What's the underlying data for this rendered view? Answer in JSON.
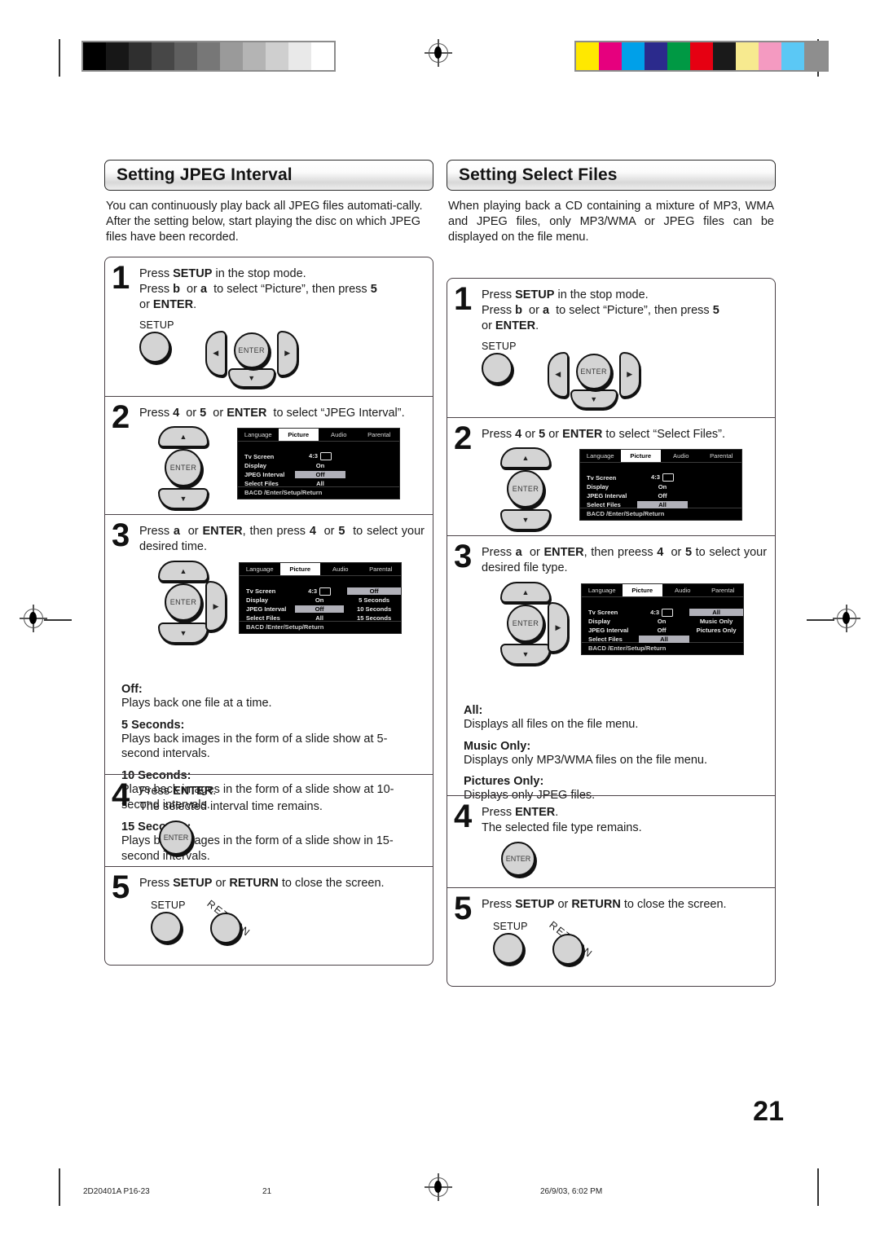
{
  "document": {
    "page_number": "21",
    "footer": {
      "doc_code": "2D20401A P16-23",
      "page_label": "21",
      "timestamp": "26/9/03, 6:02 PM"
    }
  },
  "calibration": {
    "grayscale": [
      "#000000",
      "#171717",
      "#2f2f2f",
      "#474747",
      "#5f5f5f",
      "#777777",
      "#9a9a9a",
      "#b4b4b4",
      "#cfcfcf",
      "#e9e9e9",
      "#ffffff"
    ],
    "color": [
      "#ffe800",
      "#e6007e",
      "#00a0e9",
      "#2b2a8c",
      "#009944",
      "#e60012",
      "#1a1a1a",
      "#f7ea8f",
      "#f49ac1",
      "#5bc8f5",
      "#8e8e8e"
    ]
  },
  "left_column": {
    "title": "Setting JPEG Interval",
    "intro": [
      "You can continuously play back all JPEG files automati-cally.",
      "After the setting below, start playing the disc on which JPEG files have been recorded."
    ],
    "steps": [
      {
        "number": "1",
        "lines": [
          "Press SETUP in the stop mode.",
          "Press b or a to select “Picture”, then press 5 or ENTER."
        ],
        "setup_label": "SETUP",
        "enter_label": "ENTER"
      },
      {
        "number": "2",
        "lines": [
          "Press 4 or 5 or ENTER to select “JPEG Interval”."
        ],
        "enter_label": "ENTER"
      },
      {
        "number": "3",
        "lines": [
          "Press a or ENTER, then press 4 or 5 to select your desired time."
        ],
        "enter_label": "ENTER"
      },
      {
        "number": "4",
        "lines": [
          "Press ENTER.",
          "The selected interval time remains."
        ],
        "enter_label": "ENTER"
      },
      {
        "number": "5",
        "lines": [
          "Press SETUP or RETURN to close the screen."
        ],
        "setup_label": "SETUP",
        "return_label": "RETURN"
      }
    ],
    "osd_step2": {
      "tabs": [
        "Language",
        "Picture",
        "Audio",
        "Parental"
      ],
      "active_tab": "Picture",
      "rows": [
        {
          "label": "Tv Screen",
          "value": "4:3",
          "has_tv_icon": true,
          "highlighted": false
        },
        {
          "label": "Display",
          "value": "On",
          "highlighted": false
        },
        {
          "label": "JPEG Interval",
          "value": "Off",
          "highlighted": true
        },
        {
          "label": "Select Files",
          "value": "All",
          "highlighted": false
        }
      ],
      "options": [],
      "footer": "BACD  /Enter/Setup/Return"
    },
    "osd_step3": {
      "tabs": [
        "Language",
        "Picture",
        "Audio",
        "Parental"
      ],
      "active_tab": "Picture",
      "rows": [
        {
          "label": "Tv Screen",
          "value": "4:3",
          "has_tv_icon": true,
          "highlighted": false
        },
        {
          "label": "Display",
          "value": "On",
          "highlighted": false
        },
        {
          "label": "JPEG Interval",
          "value": "Off",
          "highlighted": true
        },
        {
          "label": "Select Files",
          "value": "All",
          "highlighted": false
        }
      ],
      "options": [
        {
          "text": "Off",
          "highlighted": true
        },
        {
          "text": "5 Seconds",
          "highlighted": false
        },
        {
          "text": "10 Seconds",
          "highlighted": false
        },
        {
          "text": "15 Seconds",
          "highlighted": false
        }
      ],
      "footer": "BACD  /Enter/Setup/Return"
    },
    "definitions": [
      {
        "term": "Off:",
        "desc": "Plays back one file at a time."
      },
      {
        "term": "5 Seconds:",
        "desc": "Plays back images in the form of a slide show at 5-second intervals."
      },
      {
        "term": "10 Seconds:",
        "desc": "Plays back images in the form of a slide show at 10-second intervals."
      },
      {
        "term": "15 Seconds:",
        "desc": "Plays back images in the form of a slide show in 15-second intervals."
      }
    ]
  },
  "right_column": {
    "title": "Setting Select Files",
    "intro": [
      "When playing back a CD containing a mixture of MP3, WMA and JPEG files, only MP3/WMA or JPEG files can be displayed on the file menu."
    ],
    "steps": [
      {
        "number": "1",
        "lines": [
          "Press SETUP in the stop mode.",
          "Press b or a to select “Picture”, then press 5 or ENTER."
        ],
        "setup_label": "SETUP",
        "enter_label": "ENTER"
      },
      {
        "number": "2",
        "lines": [
          "Press 4 or 5 or ENTER to select “Select Files”."
        ],
        "enter_label": "ENTER"
      },
      {
        "number": "3",
        "lines": [
          "Press a or ENTER, then preess 4 or 5 to select your desired file type."
        ],
        "enter_label": "ENTER"
      },
      {
        "number": "4",
        "lines": [
          "Press ENTER.",
          "The selected file type remains."
        ],
        "enter_label": "ENTER"
      },
      {
        "number": "5",
        "lines": [
          "Press SETUP or RETURN to close the screen."
        ],
        "setup_label": "SETUP",
        "return_label": "RETURN"
      }
    ],
    "osd_step2": {
      "tabs": [
        "Language",
        "Picture",
        "Audio",
        "Parental"
      ],
      "active_tab": "Picture",
      "rows": [
        {
          "label": "Tv Screen",
          "value": "4:3",
          "has_tv_icon": true,
          "highlighted": false
        },
        {
          "label": "Display",
          "value": "On",
          "highlighted": false
        },
        {
          "label": "JPEG Interval",
          "value": "Off",
          "highlighted": false
        },
        {
          "label": "Select Files",
          "value": "All",
          "highlighted": true
        }
      ],
      "options": [],
      "footer": "BACD  /Enter/Setup/Return"
    },
    "osd_step3": {
      "tabs": [
        "Language",
        "Picture",
        "Audio",
        "Parental"
      ],
      "active_tab": "Picture",
      "rows": [
        {
          "label": "Tv Screen",
          "value": "4:3",
          "has_tv_icon": true,
          "highlighted": false
        },
        {
          "label": "Display",
          "value": "On",
          "highlighted": false
        },
        {
          "label": "JPEG Interval",
          "value": "Off",
          "highlighted": false
        },
        {
          "label": "Select Files",
          "value": "All",
          "highlighted": true
        }
      ],
      "options": [
        {
          "text": "All",
          "highlighted": true
        },
        {
          "text": "Music Only",
          "highlighted": false
        },
        {
          "text": "Pictures Only",
          "highlighted": false
        }
      ],
      "footer": "BACD  /Enter/Setup/Return"
    },
    "definitions": [
      {
        "term": "All:",
        "desc": "Displays all files on the file menu."
      },
      {
        "term": "Music Only:",
        "desc": "Displays only MP3/WMA files on the file menu."
      },
      {
        "term": "Pictures Only:",
        "desc": "Displays only JPEG files."
      }
    ]
  }
}
